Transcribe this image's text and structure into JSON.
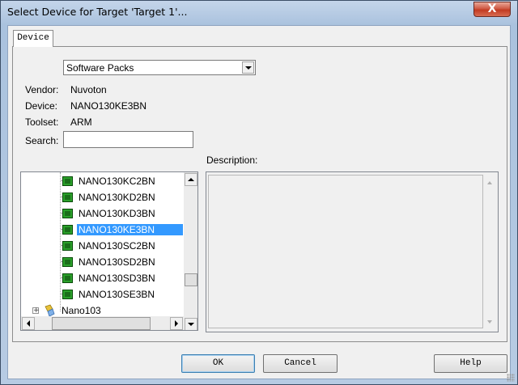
{
  "window": {
    "title": "Select Device for Target 'Target 1'...",
    "close_label": "X"
  },
  "tabs": [
    {
      "label": "Device"
    }
  ],
  "source_select": {
    "value": "Software Packs"
  },
  "info": {
    "vendor_label": "Vendor:",
    "vendor_value": "Nuvoton",
    "device_label": "Device:",
    "device_value": "NANO130KE3BN",
    "toolset_label": "Toolset:",
    "toolset_value": "ARM",
    "search_label": "Search:"
  },
  "search": {
    "value": ""
  },
  "description_label": "Description:",
  "tree": {
    "items": [
      {
        "label": "NANO130KC2BN",
        "selected": false
      },
      {
        "label": "NANO130KD2BN",
        "selected": false
      },
      {
        "label": "NANO130KD3BN",
        "selected": false
      },
      {
        "label": "NANO130KE3BN",
        "selected": true
      },
      {
        "label": "NANO130SC2BN",
        "selected": false
      },
      {
        "label": "NANO130SD2BN",
        "selected": false
      },
      {
        "label": "NANO130SD3BN",
        "selected": false
      },
      {
        "label": "NANO130SE3BN",
        "selected": false
      }
    ],
    "family": {
      "label": "Nano103",
      "expander": "+"
    }
  },
  "buttons": {
    "ok": "OK",
    "cancel": "Cancel",
    "help": "Help"
  },
  "colors": {
    "selection": "#3399ff",
    "chip": "#2aa02a"
  }
}
